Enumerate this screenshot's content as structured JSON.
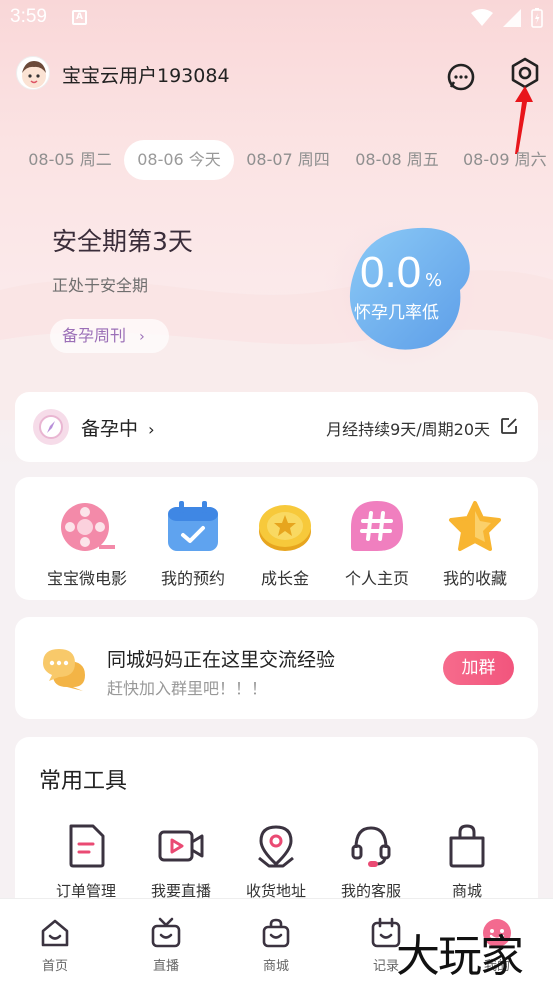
{
  "status_bar": {
    "time": "3:59",
    "a_glyph": "A"
  },
  "header": {
    "username": "宝宝云用户193084"
  },
  "dates": [
    {
      "label": "08-05 周二",
      "active": false
    },
    {
      "label": "08-06 今天",
      "active": true
    },
    {
      "label": "08-07 周四",
      "active": false
    },
    {
      "label": "08-08 周五",
      "active": false
    },
    {
      "label": "08-09 周六",
      "active": false
    }
  ],
  "period": {
    "title": "安全期第3天",
    "subtitle": "正处于安全期",
    "weekly_label": "备孕周刊",
    "probability_value": "0.0",
    "probability_unit": "%",
    "probability_label": "怀孕几率低"
  },
  "status_card": {
    "label": "备孕中",
    "cycle": "月经持续9天/周期20天"
  },
  "shortcuts": [
    {
      "label": "宝宝微电影",
      "icon": "film-reel-icon"
    },
    {
      "label": "我的预约",
      "icon": "calendar-check-icon"
    },
    {
      "label": "成长金",
      "icon": "gold-coin-icon"
    },
    {
      "label": "个人主页",
      "icon": "hashtag-bubble-icon"
    },
    {
      "label": "我的收藏",
      "icon": "star-icon"
    }
  ],
  "group": {
    "title": "同城妈妈正在这里交流经验",
    "subtitle": "赶快加入群里吧！！！",
    "join_label": "加群"
  },
  "tools": {
    "title": "常用工具",
    "items": [
      {
        "label": "订单管理",
        "icon": "document-icon"
      },
      {
        "label": "我要直播",
        "icon": "video-camera-icon"
      },
      {
        "label": "收货地址",
        "icon": "location-pin-icon"
      },
      {
        "label": "我的客服",
        "icon": "headset-icon"
      },
      {
        "label": "商城",
        "icon": "shopping-bag-icon"
      }
    ]
  },
  "tabs": [
    {
      "label": "首页",
      "icon": "home-icon"
    },
    {
      "label": "直播",
      "icon": "tv-icon"
    },
    {
      "label": "商城",
      "icon": "bag-icon"
    },
    {
      "label": "记录",
      "icon": "calendar-icon"
    },
    {
      "label": "我的",
      "icon": "profile-icon"
    }
  ],
  "watermark": "大玩家",
  "colors": {
    "accent_pink": "#f2557d",
    "bubble_blue": "#74b6f0",
    "weekly_purple": "#9b6fb7"
  }
}
